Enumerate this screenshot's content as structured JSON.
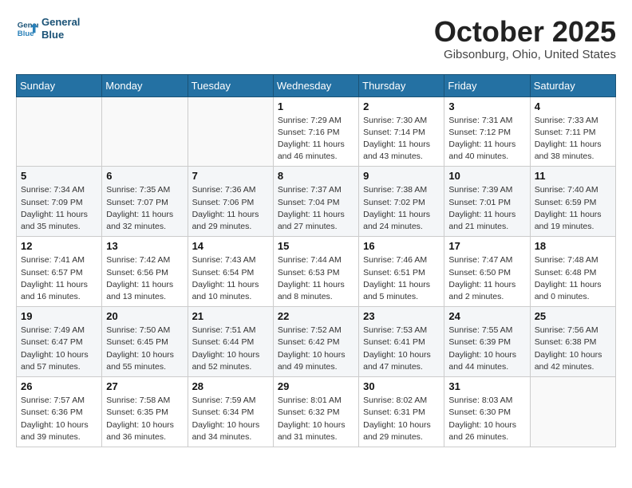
{
  "header": {
    "logo_line1": "General",
    "logo_line2": "Blue",
    "month": "October 2025",
    "location": "Gibsonburg, Ohio, United States"
  },
  "days_of_week": [
    "Sunday",
    "Monday",
    "Tuesday",
    "Wednesday",
    "Thursday",
    "Friday",
    "Saturday"
  ],
  "weeks": [
    [
      {
        "day": "",
        "info": ""
      },
      {
        "day": "",
        "info": ""
      },
      {
        "day": "",
        "info": ""
      },
      {
        "day": "1",
        "info": "Sunrise: 7:29 AM\nSunset: 7:16 PM\nDaylight: 11 hours\nand 46 minutes."
      },
      {
        "day": "2",
        "info": "Sunrise: 7:30 AM\nSunset: 7:14 PM\nDaylight: 11 hours\nand 43 minutes."
      },
      {
        "day": "3",
        "info": "Sunrise: 7:31 AM\nSunset: 7:12 PM\nDaylight: 11 hours\nand 40 minutes."
      },
      {
        "day": "4",
        "info": "Sunrise: 7:33 AM\nSunset: 7:11 PM\nDaylight: 11 hours\nand 38 minutes."
      }
    ],
    [
      {
        "day": "5",
        "info": "Sunrise: 7:34 AM\nSunset: 7:09 PM\nDaylight: 11 hours\nand 35 minutes."
      },
      {
        "day": "6",
        "info": "Sunrise: 7:35 AM\nSunset: 7:07 PM\nDaylight: 11 hours\nand 32 minutes."
      },
      {
        "day": "7",
        "info": "Sunrise: 7:36 AM\nSunset: 7:06 PM\nDaylight: 11 hours\nand 29 minutes."
      },
      {
        "day": "8",
        "info": "Sunrise: 7:37 AM\nSunset: 7:04 PM\nDaylight: 11 hours\nand 27 minutes."
      },
      {
        "day": "9",
        "info": "Sunrise: 7:38 AM\nSunset: 7:02 PM\nDaylight: 11 hours\nand 24 minutes."
      },
      {
        "day": "10",
        "info": "Sunrise: 7:39 AM\nSunset: 7:01 PM\nDaylight: 11 hours\nand 21 minutes."
      },
      {
        "day": "11",
        "info": "Sunrise: 7:40 AM\nSunset: 6:59 PM\nDaylight: 11 hours\nand 19 minutes."
      }
    ],
    [
      {
        "day": "12",
        "info": "Sunrise: 7:41 AM\nSunset: 6:57 PM\nDaylight: 11 hours\nand 16 minutes."
      },
      {
        "day": "13",
        "info": "Sunrise: 7:42 AM\nSunset: 6:56 PM\nDaylight: 11 hours\nand 13 minutes."
      },
      {
        "day": "14",
        "info": "Sunrise: 7:43 AM\nSunset: 6:54 PM\nDaylight: 11 hours\nand 10 minutes."
      },
      {
        "day": "15",
        "info": "Sunrise: 7:44 AM\nSunset: 6:53 PM\nDaylight: 11 hours\nand 8 minutes."
      },
      {
        "day": "16",
        "info": "Sunrise: 7:46 AM\nSunset: 6:51 PM\nDaylight: 11 hours\nand 5 minutes."
      },
      {
        "day": "17",
        "info": "Sunrise: 7:47 AM\nSunset: 6:50 PM\nDaylight: 11 hours\nand 2 minutes."
      },
      {
        "day": "18",
        "info": "Sunrise: 7:48 AM\nSunset: 6:48 PM\nDaylight: 11 hours\nand 0 minutes."
      }
    ],
    [
      {
        "day": "19",
        "info": "Sunrise: 7:49 AM\nSunset: 6:47 PM\nDaylight: 10 hours\nand 57 minutes."
      },
      {
        "day": "20",
        "info": "Sunrise: 7:50 AM\nSunset: 6:45 PM\nDaylight: 10 hours\nand 55 minutes."
      },
      {
        "day": "21",
        "info": "Sunrise: 7:51 AM\nSunset: 6:44 PM\nDaylight: 10 hours\nand 52 minutes."
      },
      {
        "day": "22",
        "info": "Sunrise: 7:52 AM\nSunset: 6:42 PM\nDaylight: 10 hours\nand 49 minutes."
      },
      {
        "day": "23",
        "info": "Sunrise: 7:53 AM\nSunset: 6:41 PM\nDaylight: 10 hours\nand 47 minutes."
      },
      {
        "day": "24",
        "info": "Sunrise: 7:55 AM\nSunset: 6:39 PM\nDaylight: 10 hours\nand 44 minutes."
      },
      {
        "day": "25",
        "info": "Sunrise: 7:56 AM\nSunset: 6:38 PM\nDaylight: 10 hours\nand 42 minutes."
      }
    ],
    [
      {
        "day": "26",
        "info": "Sunrise: 7:57 AM\nSunset: 6:36 PM\nDaylight: 10 hours\nand 39 minutes."
      },
      {
        "day": "27",
        "info": "Sunrise: 7:58 AM\nSunset: 6:35 PM\nDaylight: 10 hours\nand 36 minutes."
      },
      {
        "day": "28",
        "info": "Sunrise: 7:59 AM\nSunset: 6:34 PM\nDaylight: 10 hours\nand 34 minutes."
      },
      {
        "day": "29",
        "info": "Sunrise: 8:01 AM\nSunset: 6:32 PM\nDaylight: 10 hours\nand 31 minutes."
      },
      {
        "day": "30",
        "info": "Sunrise: 8:02 AM\nSunset: 6:31 PM\nDaylight: 10 hours\nand 29 minutes."
      },
      {
        "day": "31",
        "info": "Sunrise: 8:03 AM\nSunset: 6:30 PM\nDaylight: 10 hours\nand 26 minutes."
      },
      {
        "day": "",
        "info": ""
      }
    ]
  ]
}
